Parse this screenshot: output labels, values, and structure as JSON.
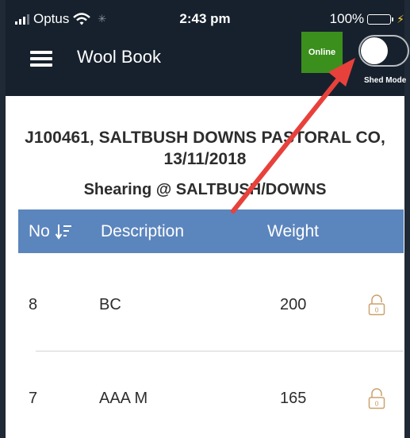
{
  "status_bar": {
    "carrier": "Optus",
    "time": "2:43 pm",
    "battery_percent": "100%",
    "battery_level": 1.0,
    "icons": [
      "signal-icon",
      "wifi-icon",
      "loading-icon",
      "battery-icon",
      "charging-icon"
    ]
  },
  "header": {
    "title": "Wool Book",
    "online_label": "Online",
    "shed_mode_label": "Shed Mode",
    "shed_mode_on": false,
    "menu_icon": "hamburger-icon"
  },
  "job": {
    "title": "J100461, SALTBUSH DOWNS PASTORAL CO, 13/11/2018",
    "subtitle": "Shearing @ SALTBUSH/DOWNS"
  },
  "table": {
    "headers": {
      "no": "No",
      "description": "Description",
      "weight": "Weight"
    },
    "sort_icon": "sort-descending-icon",
    "rows": [
      {
        "no": "8",
        "description": "BC",
        "weight": "200",
        "lock_label": "0",
        "lock_icon": "lock-icon"
      },
      {
        "no": "7",
        "description": "AAA M",
        "weight": "165",
        "lock_label": "0",
        "lock_icon": "lock-icon"
      }
    ]
  },
  "colors": {
    "header_bg": "#17212d",
    "online_badge": "#3b8f1d",
    "table_header": "#5b85bd",
    "annotation_arrow": "#e8413c",
    "battery_fill": "#43d14b"
  }
}
